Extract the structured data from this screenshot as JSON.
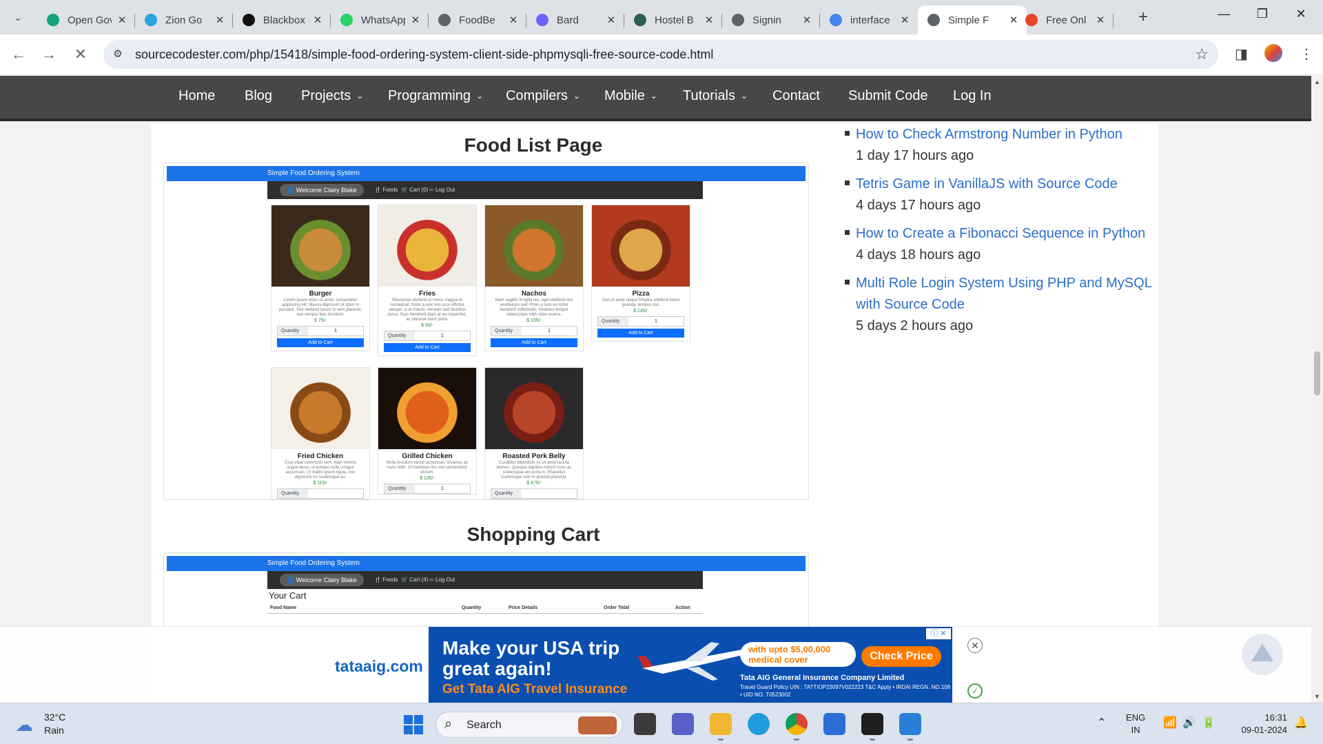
{
  "browser": {
    "tabs": [
      {
        "label": "Open Gov",
        "icon": "openai-icon",
        "color": "#10a37f"
      },
      {
        "label": "Zion Go",
        "icon": "telegram-icon",
        "color": "#2aa3df"
      },
      {
        "label": "Blackbox",
        "icon": "blackbox-icon",
        "color": "#111111"
      },
      {
        "label": "WhatsApp",
        "icon": "whatsapp-icon",
        "color": "#25d366"
      },
      {
        "label": "FoodBe",
        "icon": "globe-icon",
        "color": "#5f6368"
      },
      {
        "label": "Bard",
        "icon": "bard-sparkle-icon",
        "color": "#6c63ff"
      },
      {
        "label": "Hostel B",
        "icon": "hostel-icon",
        "color": "#2e5e4e"
      },
      {
        "label": "Signin",
        "icon": "globe-icon",
        "color": "#5f6368"
      },
      {
        "label": "interface",
        "icon": "google-icon",
        "color": "#4285f4"
      },
      {
        "label": "Simple F",
        "icon": "loading-icon",
        "color": "#5f6368"
      },
      {
        "label": "Free Onl",
        "icon": "flame-icon",
        "color": "#e8452c"
      }
    ],
    "active_tab_index": 9,
    "url": "sourcecodester.com/php/15418/simple-food-ordering-system-client-side-phpmysqli-free-source-code.html"
  },
  "site_nav": {
    "items": [
      {
        "label": "Home",
        "dropdown": false
      },
      {
        "label": "Blog",
        "dropdown": false
      },
      {
        "label": "Projects",
        "dropdown": true
      },
      {
        "label": "Programming",
        "dropdown": true
      },
      {
        "label": "Compilers",
        "dropdown": true
      },
      {
        "label": "Mobile",
        "dropdown": true
      },
      {
        "label": "Tutorials",
        "dropdown": true
      },
      {
        "label": "Contact",
        "dropdown": false
      },
      {
        "label": "Submit Code",
        "dropdown": false
      },
      {
        "label": "Log In",
        "dropdown": false
      }
    ]
  },
  "article": {
    "food_list_title": "Food List Page",
    "shopping_cart_title": "Shopping Cart",
    "app_title": "Simple Food Ordering System",
    "welcome": "Welcome Clairy Blake",
    "nav_foods": "Foods",
    "nav_cart": "Cart (0)",
    "nav_cart_2": "Cart (4)",
    "nav_logout": "Log Out",
    "quantity_label": "Quantity",
    "add_to_cart": "Add to Cart",
    "foods": [
      {
        "name": "Burger",
        "desc": "Lorem ipsum dolor sit amet, consectetur adipiscing elit. Mauris dignissim at dolor in posuere. Sed eleifend ipsum in sem placerat, sed semper felis tincidunt.",
        "price": "$ 75/-",
        "qty": "1",
        "photo": "burger-photo",
        "colors": [
          "#3b2a1c",
          "#c98a3a",
          "#6b8f2f"
        ]
      },
      {
        "name": "Fries",
        "desc": "Maecenas eleifend ut metus magna et consequat. Nunc a erat non arcu efficitur semper ut at mauris. Aenean sed faucibus purus. Duis hendrerit diam at leo imperdiet, ac placerat dolor porta.",
        "price": "$ 50/-",
        "qty": "1",
        "photo": "fries-photo",
        "colors": [
          "#f0ede6",
          "#e8b53a",
          "#c9302c"
        ]
      },
      {
        "name": "Nachos",
        "desc": "Nam sagittis fringilla leo, eget eleifend orci vestibulum sed. Proin a sem eu tortor hendrerit sollicitudin. Vivamus tempor ullamcorper nibh vitae viverra.",
        "price": "$ 105/-",
        "qty": "1",
        "photo": "nachos-photo",
        "colors": [
          "#8a5a2b",
          "#d0762c",
          "#5b7a2a"
        ]
      },
      {
        "name": "Pizza",
        "desc": "Sed sit amet neque fringilla, eleifend libero gravida, tempus nisl.",
        "price": "$ 145/-",
        "qty": "1",
        "photo": "pizza-photo",
        "colors": [
          "#b23a1e",
          "#e0a64a",
          "#7a2a14"
        ]
      },
      {
        "name": "Fried Chicken",
        "desc": "Cras vitae commodo sem. Nam viverra augue lacus, ut tempus nulla congue accumsan. Ut mattis ipsum ligula, non dignissim ex scelerisque eu.",
        "price": "$ 115/-",
        "qty": "",
        "photo": "fried-chicken-photo",
        "colors": [
          "#f4efe8",
          "#c77a2a",
          "#8a4a14"
        ]
      },
      {
        "name": "Grilled Chicken",
        "desc": "Nulla tincidunt varius accumsan. Vivamus ac nunc nibh. Ut maximus nisi sed consectetur dictum.",
        "price": "$ 135/-",
        "qty": "1",
        "photo": "grilled-chicken-photo",
        "colors": [
          "#1a0e08",
          "#e0601a",
          "#f0a030"
        ]
      },
      {
        "name": "Roasted Pork Belly",
        "desc": "Curabitur bibendum mi sit amet lacinia laoreet. Quisque dapibus rutrum nunc ac scelerisque elit porta in. Phasellus scelerisque sem in gravida placerat.",
        "price": "$ 475/-",
        "qty": "",
        "photo": "pork-belly-photo",
        "colors": [
          "#2a2a2a",
          "#b8442a",
          "#7a1e14"
        ]
      }
    ],
    "cart": {
      "heading": "Your Cart",
      "headers": [
        "Food Name",
        "Quantity",
        "Price Details",
        "Order Total",
        "Action"
      ]
    }
  },
  "sidebar": {
    "recent": [
      {
        "title": "How to Check Armstrong Number in Python",
        "time": "1 day 17 hours ago"
      },
      {
        "title": "Tetris Game in VanillaJS with Source Code",
        "time": "4 days 17 hours ago"
      },
      {
        "title": "How to Create a Fibonacci Sequence in Python",
        "time": "4 days 18 hours ago"
      },
      {
        "title": "Multi Role Login System Using PHP and MySQL with Source Code",
        "time": "5 days 2 hours ago"
      }
    ]
  },
  "ad": {
    "site": "tataaig.com",
    "headline_1": "Make your USA trip",
    "headline_2": "great again!",
    "tagline": "Get Tata AIG Travel Insurance",
    "cover": "with upto $5,00,000 medical cover",
    "cta": "Check Price",
    "company": "Tata AIG General Insurance Company Limited",
    "legal": "Travel Guard Policy UIN : TATTIOP23097V022223 T&C Apply • IRDAI REGN. NO.108 • UID NO. T0523002"
  },
  "taskbar": {
    "temperature": "32°C",
    "weather": "Rain",
    "search_placeholder": "Search",
    "language": "ENG",
    "region": "IN",
    "time": "16:31",
    "date": "09-01-2024"
  }
}
